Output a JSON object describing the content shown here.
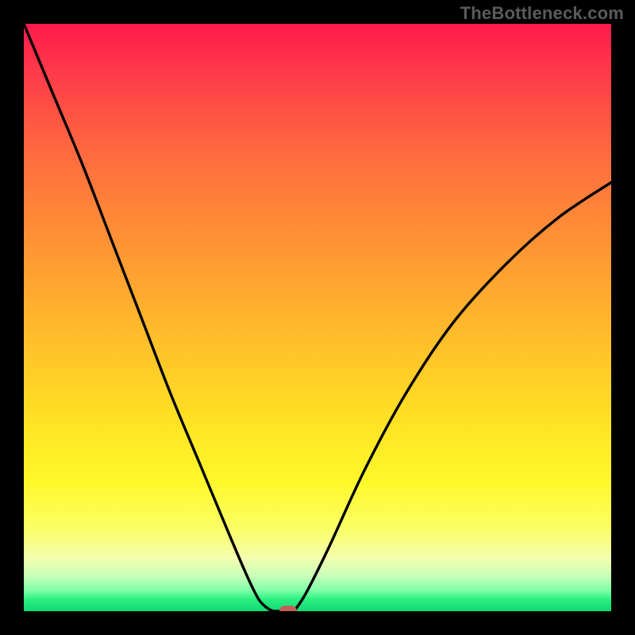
{
  "watermark": "TheBottleneck.com",
  "chart_data": {
    "type": "line",
    "title": "",
    "xlabel": "",
    "ylabel": "",
    "xlim": [
      0,
      100
    ],
    "ylim": [
      0,
      100
    ],
    "grid": false,
    "legend": false,
    "series": [
      {
        "name": "left-branch",
        "x": [
          0,
          5,
          10,
          15,
          20,
          25,
          30,
          35,
          38,
          40,
          41.5,
          42.5
        ],
        "y": [
          100,
          88,
          76,
          63,
          50,
          37,
          25,
          13,
          6,
          2,
          0.5,
          0
        ]
      },
      {
        "name": "flat-trough",
        "x": [
          42.5,
          46
        ],
        "y": [
          0,
          0
        ]
      },
      {
        "name": "right-branch",
        "x": [
          46,
          48,
          52,
          58,
          65,
          73,
          82,
          91,
          100
        ],
        "y": [
          0,
          3,
          11,
          24,
          37,
          49,
          59,
          67,
          73
        ]
      }
    ],
    "marker": {
      "x": 45,
      "y": 0,
      "color": "#c06058"
    },
    "gradient_stops": [
      {
        "pos": 0,
        "color": "#ff1a4c"
      },
      {
        "pos": 8,
        "color": "#ff394a"
      },
      {
        "pos": 22,
        "color": "#ff6a3e"
      },
      {
        "pos": 38,
        "color": "#ff9534"
      },
      {
        "pos": 54,
        "color": "#ffbf2a"
      },
      {
        "pos": 68,
        "color": "#ffe323"
      },
      {
        "pos": 78,
        "color": "#fff82a"
      },
      {
        "pos": 86,
        "color": "#fbff66"
      },
      {
        "pos": 91,
        "color": "#f3ffb0"
      },
      {
        "pos": 94,
        "color": "#c8ffb9"
      },
      {
        "pos": 96.5,
        "color": "#7dffa7"
      },
      {
        "pos": 98,
        "color": "#2bf07f"
      },
      {
        "pos": 100,
        "color": "#10d872"
      }
    ]
  }
}
